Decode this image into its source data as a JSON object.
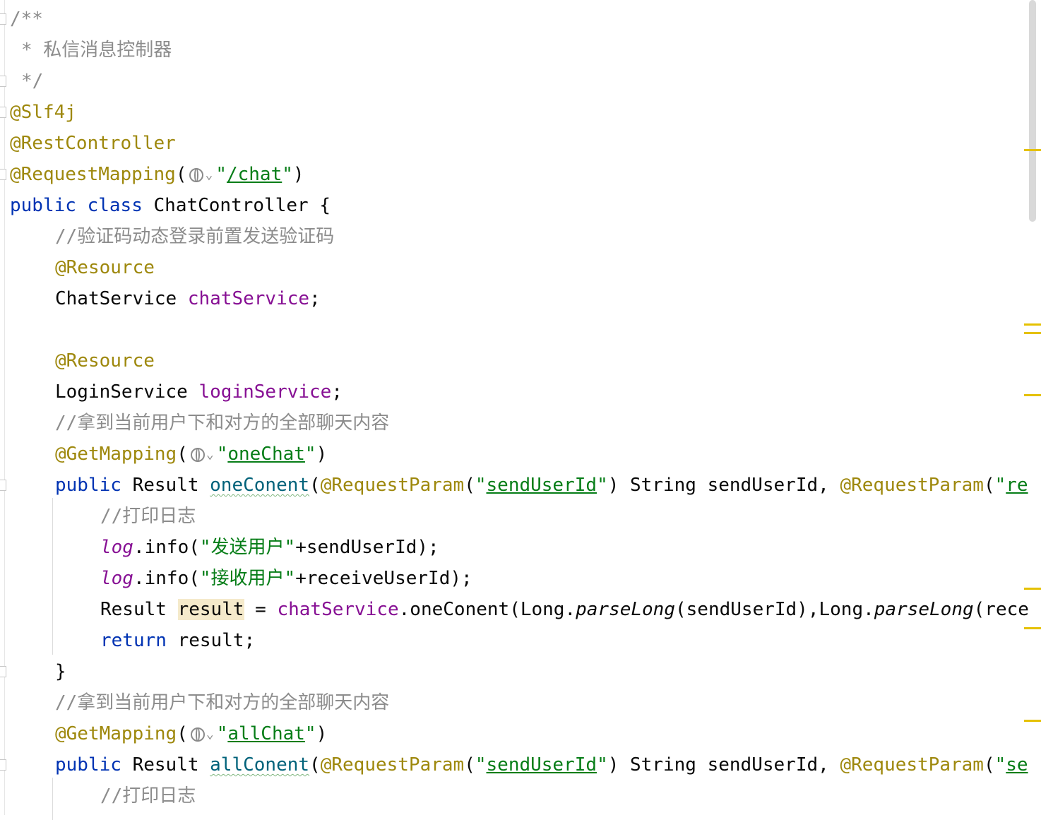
{
  "code": {
    "lines": [
      {
        "indent": 0,
        "tokens": [
          {
            "t": "/**",
            "s": "c"
          }
        ]
      },
      {
        "indent": 1,
        "tokens": [
          {
            "t": "* 私信消息控制器",
            "s": "c"
          }
        ]
      },
      {
        "indent": 1,
        "tokens": [
          {
            "t": "*/",
            "s": "c"
          }
        ]
      },
      {
        "indent": 0,
        "tokens": [
          {
            "t": "@Slf4j",
            "s": "ann"
          }
        ]
      },
      {
        "indent": 0,
        "tokens": [
          {
            "t": "@RestController",
            "s": "ann"
          }
        ]
      },
      {
        "indent": 0,
        "tokens": [
          {
            "t": "@RequestMapping",
            "s": "ann"
          },
          {
            "t": "(",
            "s": ""
          },
          {
            "globe": true
          },
          {
            "t": "\"",
            "s": "str"
          },
          {
            "t": "/chat",
            "s": "strl"
          },
          {
            "t": "\"",
            "s": "str"
          },
          {
            "t": ")",
            "s": ""
          }
        ]
      },
      {
        "indent": 0,
        "tokens": [
          {
            "t": "public",
            "s": "kw"
          },
          {
            "t": " ",
            "s": ""
          },
          {
            "t": "class",
            "s": "kw"
          },
          {
            "t": " ChatController {",
            "s": ""
          }
        ]
      },
      {
        "indent": 4,
        "tokens": [
          {
            "t": "//验证码动态登录前置发送验证码",
            "s": "c"
          }
        ]
      },
      {
        "indent": 4,
        "tokens": [
          {
            "t": "@Resource",
            "s": "ann"
          }
        ]
      },
      {
        "indent": 4,
        "tokens": [
          {
            "t": "ChatService ",
            "s": ""
          },
          {
            "t": "chatService",
            "s": "fld"
          },
          {
            "t": ";",
            "s": ""
          }
        ]
      },
      {
        "indent": 0,
        "tokens": []
      },
      {
        "indent": 4,
        "tokens": [
          {
            "t": "@Resource",
            "s": "ann"
          }
        ]
      },
      {
        "indent": 4,
        "tokens": [
          {
            "t": "LoginService ",
            "s": ""
          },
          {
            "t": "loginService",
            "s": "fld"
          },
          {
            "t": ";",
            "s": ""
          }
        ]
      },
      {
        "indent": 4,
        "tokens": [
          {
            "t": "//拿到当前用户下和对方的全部聊天内容",
            "s": "c"
          }
        ]
      },
      {
        "indent": 4,
        "tokens": [
          {
            "t": "@GetMapping",
            "s": "ann"
          },
          {
            "t": "(",
            "s": ""
          },
          {
            "globe": true
          },
          {
            "t": "\"",
            "s": "str"
          },
          {
            "t": "oneChat",
            "s": "strl"
          },
          {
            "t": "\"",
            "s": "str"
          },
          {
            "t": ")",
            "s": ""
          }
        ]
      },
      {
        "indent": 4,
        "tokens": [
          {
            "t": "public",
            "s": "kw"
          },
          {
            "t": " Result ",
            "s": ""
          },
          {
            "t": "oneConent",
            "s": "squig"
          },
          {
            "t": "(",
            "s": ""
          },
          {
            "t": "@RequestParam",
            "s": "ann"
          },
          {
            "t": "(",
            "s": ""
          },
          {
            "t": "\"",
            "s": "str"
          },
          {
            "t": "sendUserId",
            "s": "strl"
          },
          {
            "t": "\"",
            "s": "str"
          },
          {
            "t": ") String sendUserId, ",
            "s": ""
          },
          {
            "t": "@RequestParam",
            "s": "ann"
          },
          {
            "t": "(",
            "s": ""
          },
          {
            "t": "\"",
            "s": "str"
          },
          {
            "t": "re",
            "s": "strl"
          }
        ]
      },
      {
        "indent": 8,
        "tokens": [
          {
            "t": "//打印日志",
            "s": "c"
          }
        ]
      },
      {
        "indent": 8,
        "tokens": [
          {
            "t": "log",
            "s": "fldi"
          },
          {
            "t": ".info(",
            "s": ""
          },
          {
            "t": "\"发送用户\"",
            "s": "str"
          },
          {
            "t": "+sendUserId);",
            "s": ""
          }
        ]
      },
      {
        "indent": 8,
        "tokens": [
          {
            "t": "log",
            "s": "fldi"
          },
          {
            "t": ".info(",
            "s": ""
          },
          {
            "t": "\"接收用户\"",
            "s": "str"
          },
          {
            "t": "+receiveUserId);",
            "s": ""
          }
        ]
      },
      {
        "indent": 8,
        "tokens": [
          {
            "t": "Result ",
            "s": ""
          },
          {
            "t": "result",
            "s": "hl"
          },
          {
            "t": " = ",
            "s": ""
          },
          {
            "t": "chatService",
            "s": "fld"
          },
          {
            "t": ".oneConent(Long.",
            "s": ""
          },
          {
            "t": "parseLong",
            "s": "mi"
          },
          {
            "t": "(sendUserId),Long.",
            "s": ""
          },
          {
            "t": "parseLong",
            "s": "mi"
          },
          {
            "t": "(rece",
            "s": ""
          }
        ]
      },
      {
        "indent": 8,
        "tokens": [
          {
            "t": "return",
            "s": "kw"
          },
          {
            "t": " result;",
            "s": ""
          }
        ]
      },
      {
        "indent": 4,
        "tokens": [
          {
            "t": "}",
            "s": ""
          }
        ]
      },
      {
        "indent": 4,
        "tokens": [
          {
            "t": "//拿到当前用户下和对方的全部聊天内容",
            "s": "c"
          }
        ]
      },
      {
        "indent": 4,
        "tokens": [
          {
            "t": "@GetMapping",
            "s": "ann"
          },
          {
            "t": "(",
            "s": ""
          },
          {
            "globe": true
          },
          {
            "t": "\"",
            "s": "str"
          },
          {
            "t": "allChat",
            "s": "strl"
          },
          {
            "t": "\"",
            "s": "str"
          },
          {
            "t": ")",
            "s": ""
          }
        ]
      },
      {
        "indent": 4,
        "tokens": [
          {
            "t": "public",
            "s": "kw"
          },
          {
            "t": " Result ",
            "s": ""
          },
          {
            "t": "allConent",
            "s": "squig"
          },
          {
            "t": "(",
            "s": ""
          },
          {
            "t": "@RequestParam",
            "s": "ann"
          },
          {
            "t": "(",
            "s": ""
          },
          {
            "t": "\"",
            "s": "str"
          },
          {
            "t": "sendUserId",
            "s": "strl"
          },
          {
            "t": "\"",
            "s": "str"
          },
          {
            "t": ") String sendUserId, ",
            "s": ""
          },
          {
            "t": "@RequestParam",
            "s": "ann"
          },
          {
            "t": "(",
            "s": ""
          },
          {
            "t": "\"",
            "s": "str"
          },
          {
            "t": "se",
            "s": "strl"
          }
        ]
      },
      {
        "indent": 8,
        "tokens": [
          {
            "t": "//打印日志",
            "s": "c"
          }
        ]
      }
    ]
  }
}
